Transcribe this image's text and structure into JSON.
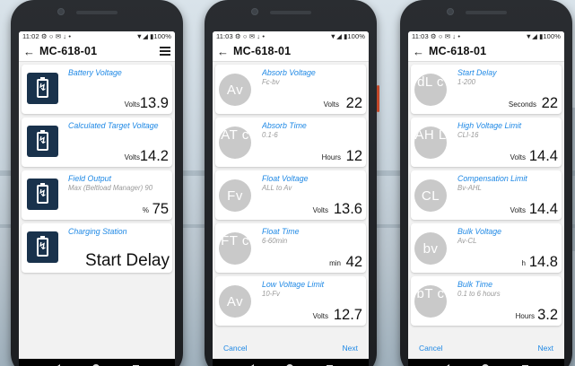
{
  "phones": [
    {
      "status_time": "11:02",
      "status_icons": "⚙ ○ ✉ ↓ •",
      "status_right": "▼◢ ▮100%",
      "title": "MC-618-01",
      "show_menu": true,
      "cards": [
        {
          "label": "Battery Voltage",
          "unit": "Volts",
          "value": "13.9",
          "icon": "battery-icon"
        },
        {
          "label": "Calculated Target Voltage",
          "unit": "Volts",
          "value": "14.2",
          "icon": "battery-icon"
        },
        {
          "label": "Field Output",
          "sub": "Max (Beltload Manager) 90",
          "unit": "%",
          "value": "75",
          "icon": "battery-icon"
        },
        {
          "label": "Charging Station",
          "value": "Start Delay",
          "icon": "battery-icon"
        }
      ]
    },
    {
      "status_time": "11:03",
      "status_icons": "⚙ ○ ✉ ↓ •",
      "status_right": "▼◢ ▮100%",
      "title": "MC-618-01",
      "cards": [
        {
          "avatar": "Av",
          "label": "Absorb Voltage",
          "sub": "Fc-bv",
          "unit": "Volts",
          "value": "22"
        },
        {
          "avatar": "AT c",
          "label": "Absorb Time",
          "sub": "0.1-6",
          "unit": "Hours",
          "value": "12"
        },
        {
          "avatar": "Fv",
          "label": "Float Voltage",
          "sub": "ALL to Av",
          "unit": "Volts",
          "value": "13.6"
        },
        {
          "avatar": "FT c",
          "label": "Float Time",
          "sub": "6-60min",
          "unit": "min",
          "value": "42"
        },
        {
          "avatar": "Av",
          "label": "Low Voltage Limit",
          "sub": "10-Fv",
          "unit": "Volts",
          "value": "12.7"
        }
      ],
      "footer": {
        "cancel": "Cancel",
        "next": "Next"
      }
    },
    {
      "status_time": "11:03",
      "status_icons": "⚙ ○ ✉ ↓ •",
      "status_right": "▼◢ ▮100%",
      "title": "MC-618-01",
      "cards": [
        {
          "avatar": "dL c",
          "label": "Start Delay",
          "sub": "1-200",
          "unit": "Seconds",
          "value": "22"
        },
        {
          "avatar": "AH L",
          "label": "High Voltage Limit",
          "sub": "CLI-16",
          "unit": "Volts",
          "value": "14.4"
        },
        {
          "avatar": "CL",
          "label": "Compensation Limit",
          "sub": "Bv-AHL",
          "unit": "Volts",
          "value": "14.4"
        },
        {
          "avatar": "bv",
          "label": "Bulk Voltage",
          "sub": "Av-CL",
          "unit": "h",
          "value": "14.8"
        },
        {
          "avatar": "bT c",
          "label": "Bulk Time",
          "sub": "0.1 to 6 hours",
          "unit": "Hours",
          "value": "3.2"
        }
      ],
      "footer": {
        "cancel": "Cancel",
        "next": "Next"
      }
    }
  ]
}
